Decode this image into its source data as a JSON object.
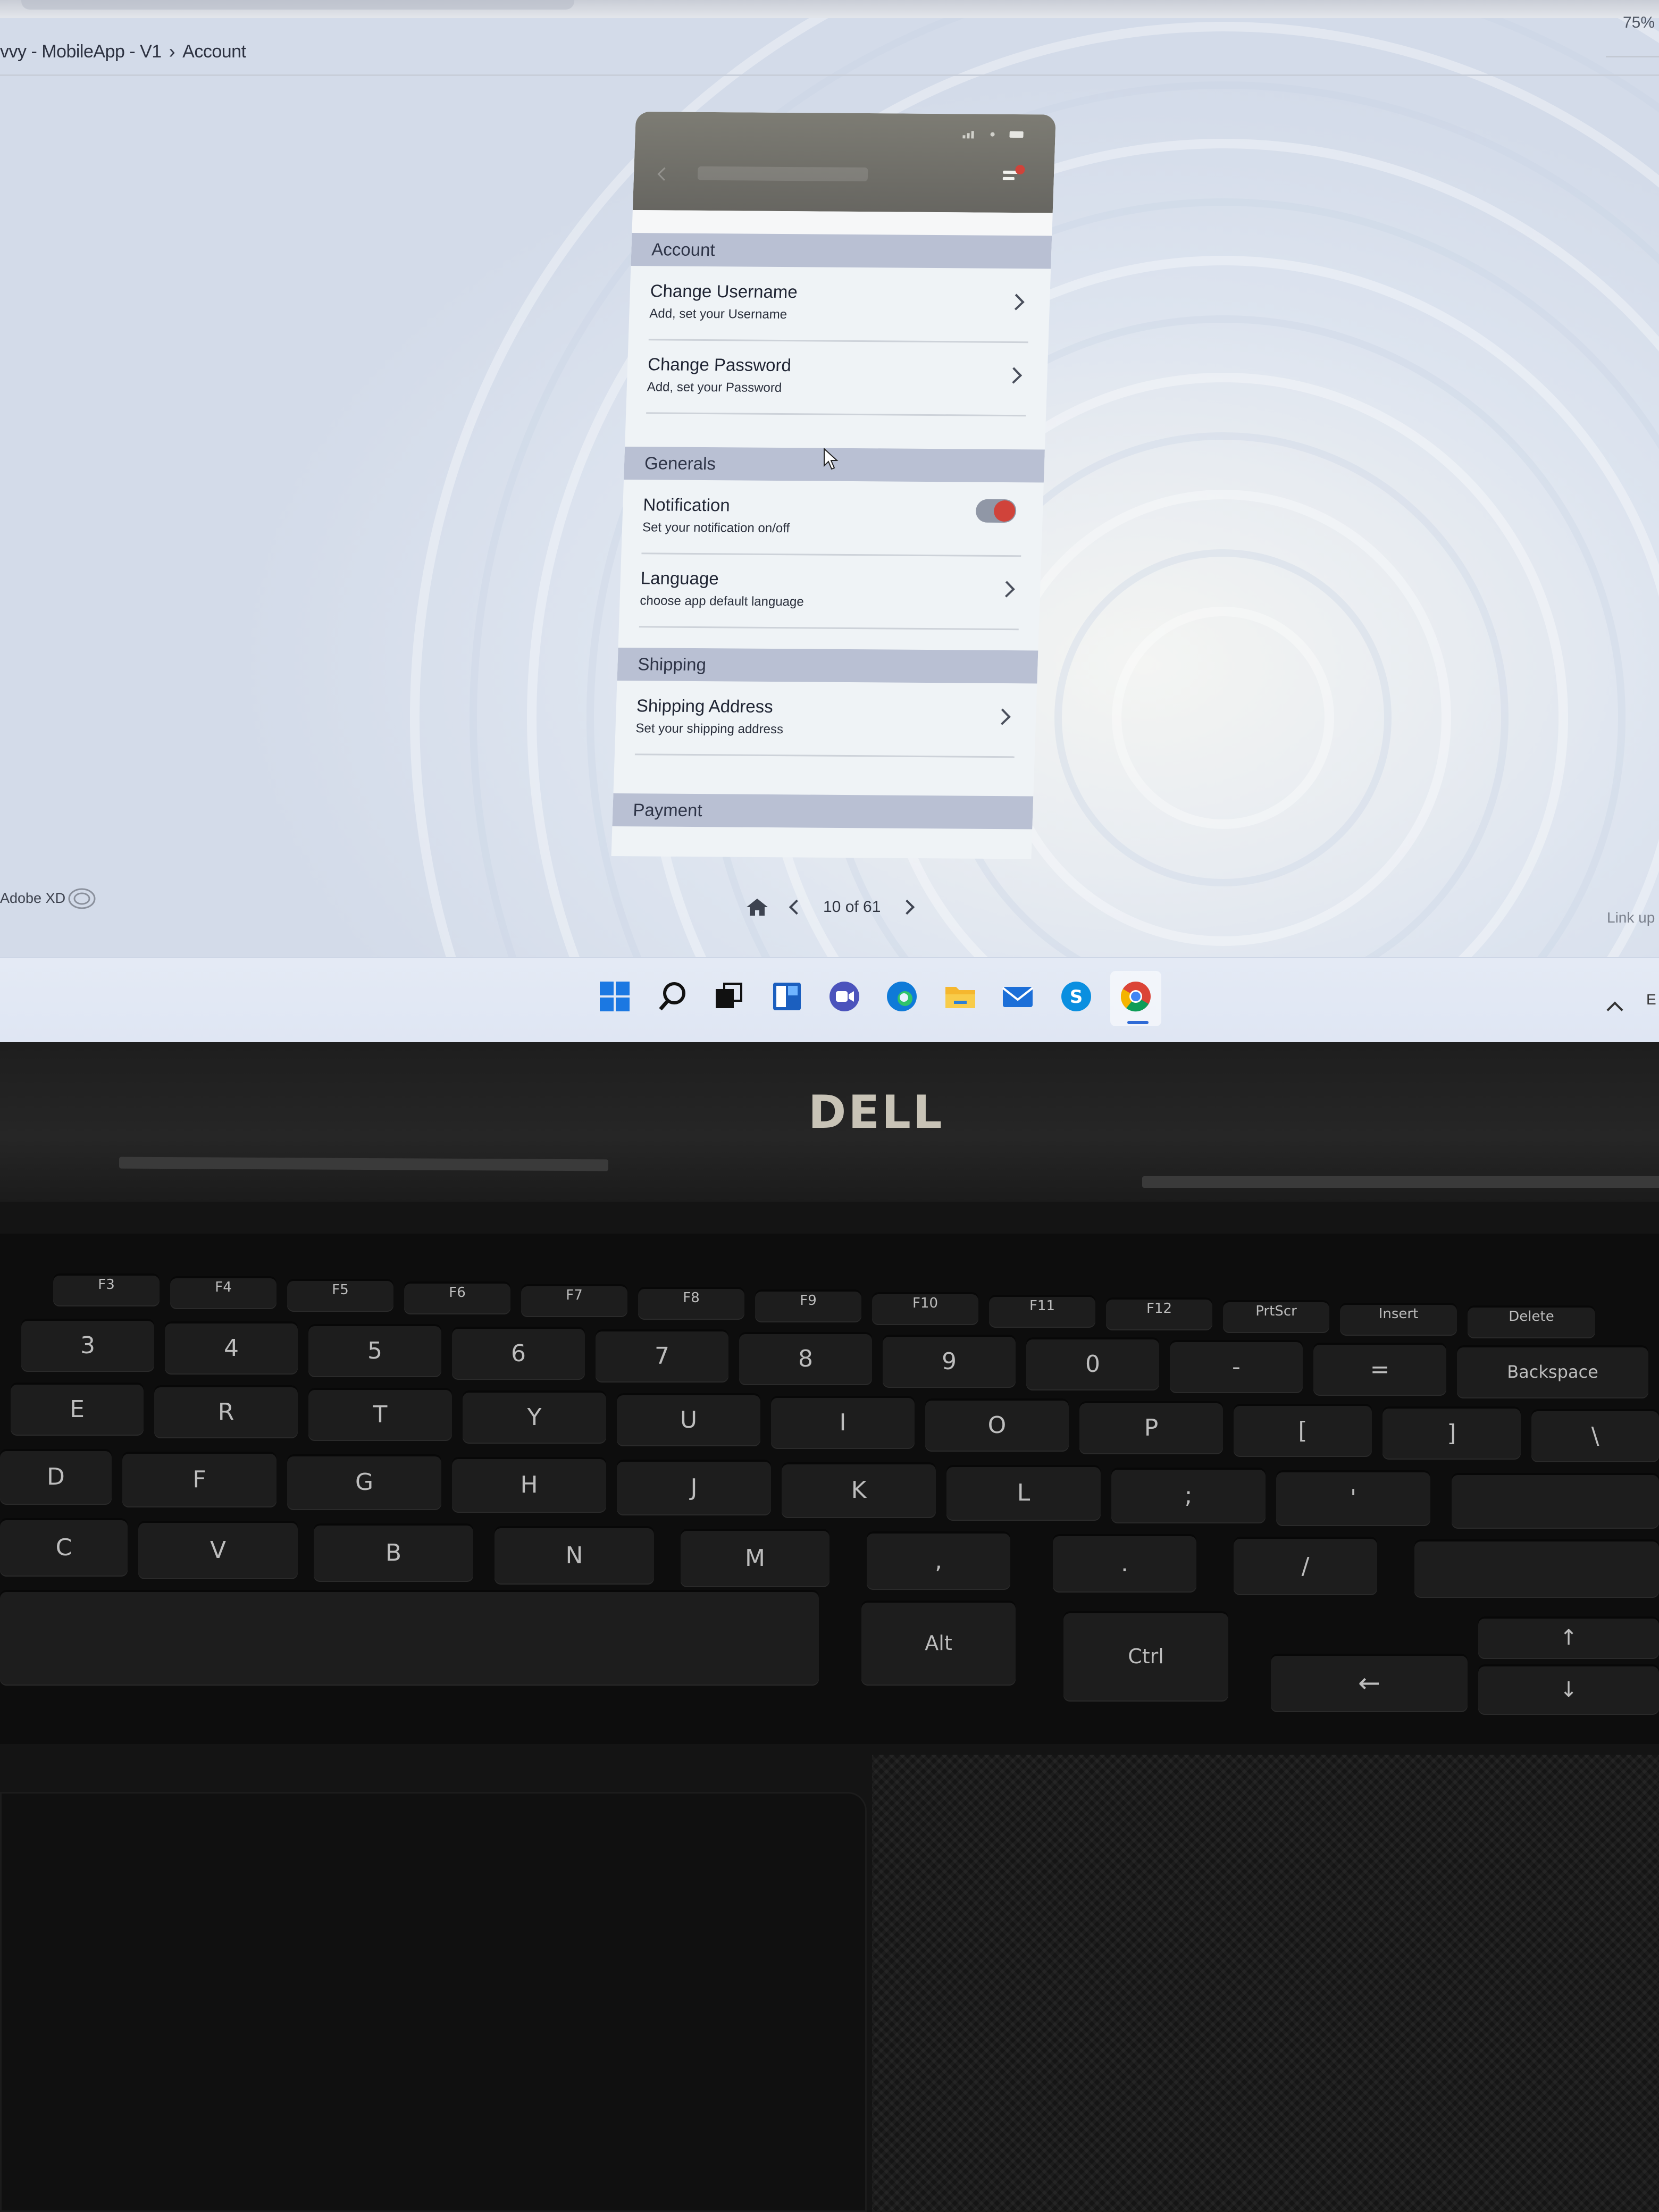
{
  "browser": {
    "zoom": "75%",
    "breadcrumb": [
      "vvy - MobileApp - V1",
      "Account"
    ]
  },
  "phone_screen": {
    "sections": [
      {
        "header": "Account",
        "rows": [
          {
            "title": "Change Username",
            "subtitle": "Add, set your Username",
            "control": "chevron"
          },
          {
            "title": "Change Password",
            "subtitle": "Add, set your Password",
            "control": "chevron"
          }
        ]
      },
      {
        "header": "Generals",
        "rows": [
          {
            "title": "Notification",
            "subtitle": "Set your notification on/off",
            "control": "toggle",
            "toggle_on": true
          },
          {
            "title": "Language",
            "subtitle": "choose app default language",
            "control": "chevron"
          }
        ]
      },
      {
        "header": "Shipping",
        "rows": [
          {
            "title": "Shipping Address",
            "subtitle": "Set your shipping address",
            "control": "chevron"
          }
        ]
      },
      {
        "header": "Payment",
        "rows": []
      }
    ],
    "colors": {
      "header_bar": "#6f6e68",
      "section_band": "#b9c0d3",
      "toggle_knob": "#d0433a"
    }
  },
  "xd_footer": {
    "app_label": "Adobe XD",
    "page_indicator": "10 of 61",
    "link_label": "Link up"
  },
  "taskbar": {
    "icons": [
      "windows-start-icon",
      "search-icon",
      "task-view-icon",
      "widgets-icon",
      "teams-chat-icon",
      "edge-icon",
      "file-explorer-icon",
      "mail-icon",
      "skype-icon",
      "chrome-icon"
    ],
    "active": "chrome-icon",
    "tray_text": "E"
  },
  "laptop": {
    "brand": "DELL",
    "keyboard": {
      "fn_row": [
        "F3",
        "F4",
        "F5",
        "F6",
        "F7",
        "F8",
        "F9",
        "F10",
        "F11",
        "F12",
        "PrtScr",
        "Insert",
        "Delete"
      ],
      "number_row": [
        "3",
        "4",
        "5",
        "6",
        "7",
        "8",
        "9",
        "0",
        "-",
        "=",
        "Backspace"
      ],
      "number_row_shift": [
        "#",
        "$",
        "%",
        "^",
        "&",
        "*",
        "(",
        ")",
        "_",
        "+"
      ],
      "row_q": [
        "E",
        "R",
        "T",
        "Y",
        "U",
        "I",
        "O",
        "P",
        "[",
        "]",
        "\\"
      ],
      "row_a": [
        "D",
        "F",
        "G",
        "H",
        "J",
        "K",
        "L",
        ";",
        "'"
      ],
      "row_z": [
        "C",
        "V",
        "B",
        "N",
        "M",
        ",",
        ".",
        "/"
      ],
      "bottom_row": [
        "Alt",
        "Ctrl"
      ]
    }
  }
}
